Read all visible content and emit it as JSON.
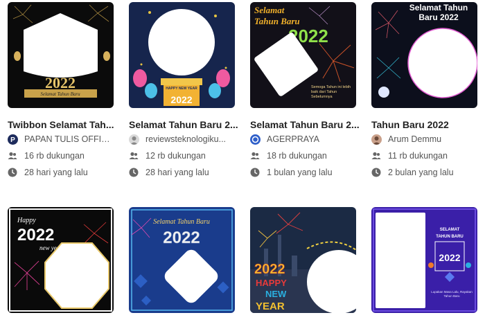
{
  "cards": [
    {
      "title": "Twibbon Selamat Tah...",
      "author": "PAPAN TULIS OFFICI...",
      "supporters": "16 rb dukungan",
      "time": "28 hari yang lalu",
      "art_text": "2022",
      "art_sub": "Selamat Tahun Baru"
    },
    {
      "title": "Selamat Tahun Baru 2...",
      "author": "reviewsteknologiku...",
      "supporters": "12 rb dukungan",
      "time": "28 hari yang lalu",
      "art_text": "2022",
      "art_sub": "HAPPY NEW YEAR"
    },
    {
      "title": "Selamat Tahun Baru 2...",
      "author": "AGERPRAYA",
      "supporters": "18 rb dukungan",
      "time": "1 bulan yang lalu",
      "art_text": "2022",
      "art_sub": "Selamat",
      "art_sub2": "Tahun Baru",
      "art_caption": "Semoga Tahun ini lebih baik dari Tahun Sebelumnya"
    },
    {
      "title": "Tahun Baru 2022",
      "author": "Arum Demmu",
      "supporters": "11 rb dukungan",
      "time": "2 bulan yang lalu",
      "art_text": "Selamat Tahun Baru 2022"
    },
    {
      "art_text": "2022",
      "art_sub": "Happy",
      "art_sub2": "new year"
    },
    {
      "art_text": "2022",
      "art_sub": "Selamat Tahun Baru"
    },
    {
      "art_text": "2022",
      "art_sub": "HAPPY",
      "art_sub2": "NEW",
      "art_sub3": "YEAR"
    },
    {
      "art_text": "2022",
      "art_sub": "SELAMAT",
      "art_sub2": "TAHUN BARU",
      "art_caption": "Lupakan Masa Lalu, Rayakan Tahun Baru"
    }
  ],
  "colors": {
    "accent": "#f0c040",
    "text": "#222222",
    "meta": "#555555"
  }
}
